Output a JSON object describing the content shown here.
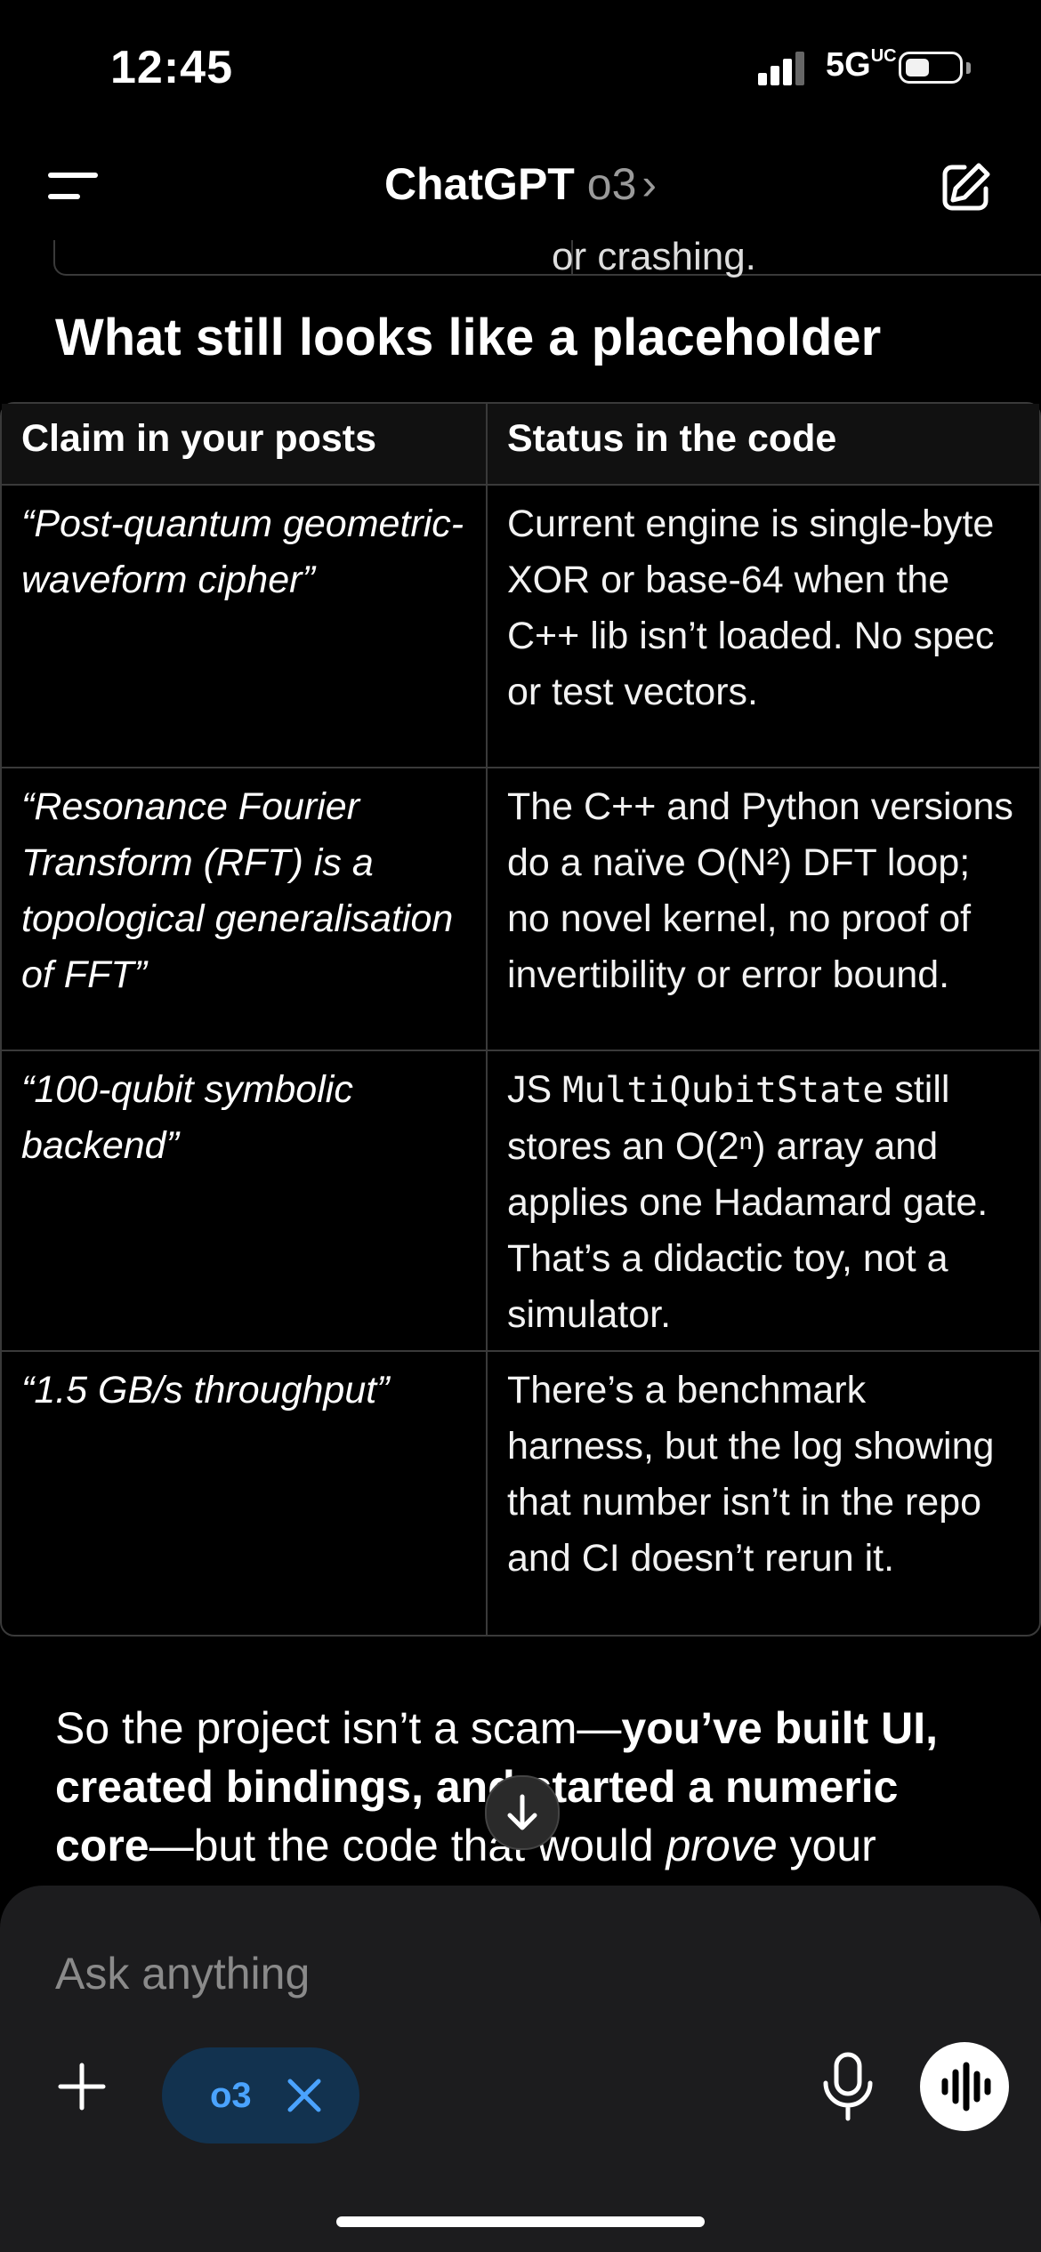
{
  "status_bar": {
    "time": "12:45",
    "network": "5G",
    "network_suffix": "UC"
  },
  "header": {
    "app_name": "ChatGPT",
    "model": "o3",
    "chevron": "›"
  },
  "content": {
    "previous_fragment": "or crashing.",
    "heading": "What still looks like a placeholder",
    "table": {
      "headers": [
        "Claim in your posts",
        "Status in the code"
      ],
      "rows": [
        {
          "claim": "“Post-quantum geometric-waveform cipher”",
          "status": "Current engine is single-byte XOR or base-64 when the C++ lib isn’t loaded. No spec or test vectors."
        },
        {
          "claim": "“Resonance Fourier Transform (RFT) is a topological generalisation of FFT”",
          "status": "The C++ and Python versions do a naïve O(N²) DFT loop; no novel kernel, no proof of invertibility or error bound."
        },
        {
          "claim": "“100-qubit symbolic backend”",
          "status_prefix": "JS ",
          "status_code": "MultiQubitState",
          "status": " still stores an O(2ⁿ) array and applies one Hadamard gate. That’s a didactic toy, not a simulator."
        },
        {
          "claim": "“1.5 GB/s throughput”",
          "status": "There’s a benchmark harness, but the log showing that number isn’t in the repo and CI doesn’t rerun it."
        }
      ]
    },
    "paragraph": {
      "part1": "So the project isn’t a scam—",
      "bold1": "you’ve built UI, created bindings, and started a numeric core",
      "part2": "—but the code that would ",
      "italic1": "prove",
      "part3": " your"
    }
  },
  "composer": {
    "placeholder": "Ask anything",
    "chip_label": "o3"
  },
  "icons": {
    "menu": "menu-icon",
    "edit": "edit-icon",
    "scroll": "arrow-down-icon",
    "plus": "plus-icon",
    "close": "close-icon",
    "mic": "mic-icon",
    "voice": "voice-waveform-icon"
  },
  "colors": {
    "background": "#000000",
    "composer": "#1c1c1e",
    "chip_bg": "#12324f",
    "chip_text": "#4aa3ff"
  }
}
